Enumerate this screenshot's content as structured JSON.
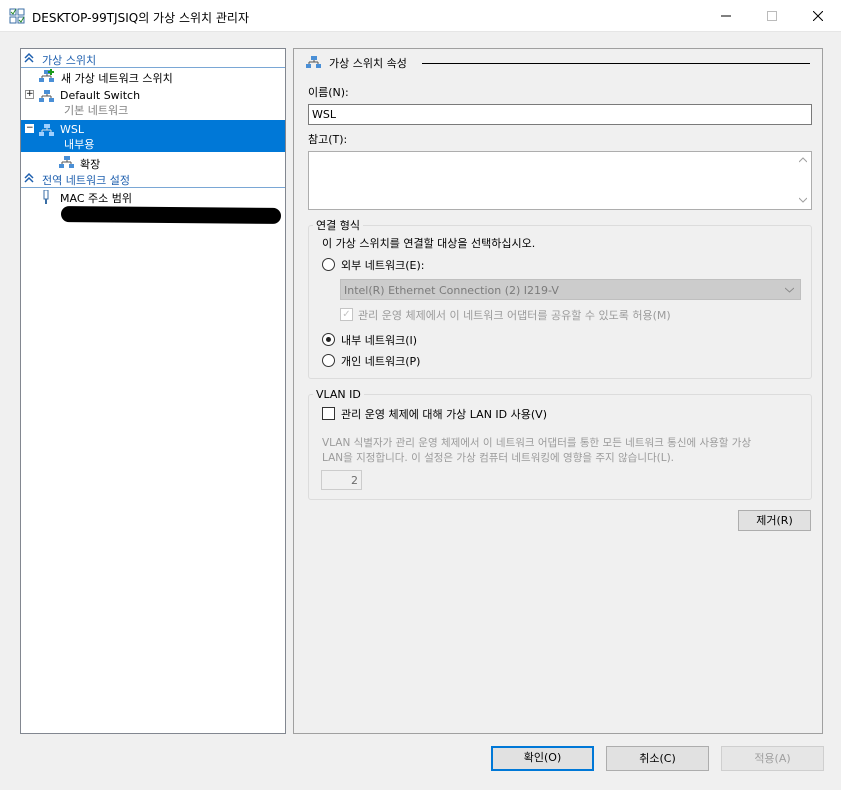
{
  "window": {
    "title": "DESKTOP-99TJSIQ의 가상 스위치 관리자"
  },
  "tree": {
    "section_switches": "가상 스위치",
    "new_switch": "새 가상 네트워크 스위치",
    "default_switch": {
      "name": "Default Switch",
      "type": "기본 네트워크"
    },
    "wsl": {
      "name": "WSL",
      "type": "내부용"
    },
    "extensions": "확장",
    "section_global": "전역 네트워크 설정",
    "mac_range": "MAC 주소 범위"
  },
  "props": {
    "title": "가상 스위치 속성",
    "name_label": "이름(N):",
    "name_value": "WSL",
    "notes_label": "참고(T):",
    "notes_value": "",
    "conn_legend": "연결 형식",
    "conn_desc": "이 가상 스위치를 연결할 대상을 선택하십시오.",
    "external_label": "외부 네트워크(E):",
    "adapter_value": "Intel(R) Ethernet Connection (2) I219-V",
    "share_label": "관리 운영 체제에서 이 네트워크 어댑터를 공유할 수 있도록 허용(M)",
    "internal_label": "내부 네트워크(I)",
    "private_label": "개인 네트워크(P)",
    "selected_type": "internal",
    "vlan_legend": "VLAN ID",
    "vlan_check_label": "관리 운영 체제에 대해 가상 LAN ID 사용(V)",
    "vlan_desc1": "VLAN 식별자가 관리 운영 체제에서 이 네트워크 어댑터를 통한 모든 네트워크 통신에 사용할 가상",
    "vlan_desc2": "LAN을 지정합니다. 이 설정은 가상 컴퓨터 네트워킹에 영향을 주지 않습니다(L).",
    "vlan_value": "2",
    "remove_button": "제거(R)"
  },
  "footer": {
    "ok": "확인(O)",
    "cancel": "취소(C)",
    "apply": "적용(A)"
  },
  "colors": {
    "selection": "#0078d7",
    "section_header": "#1e5fae"
  }
}
